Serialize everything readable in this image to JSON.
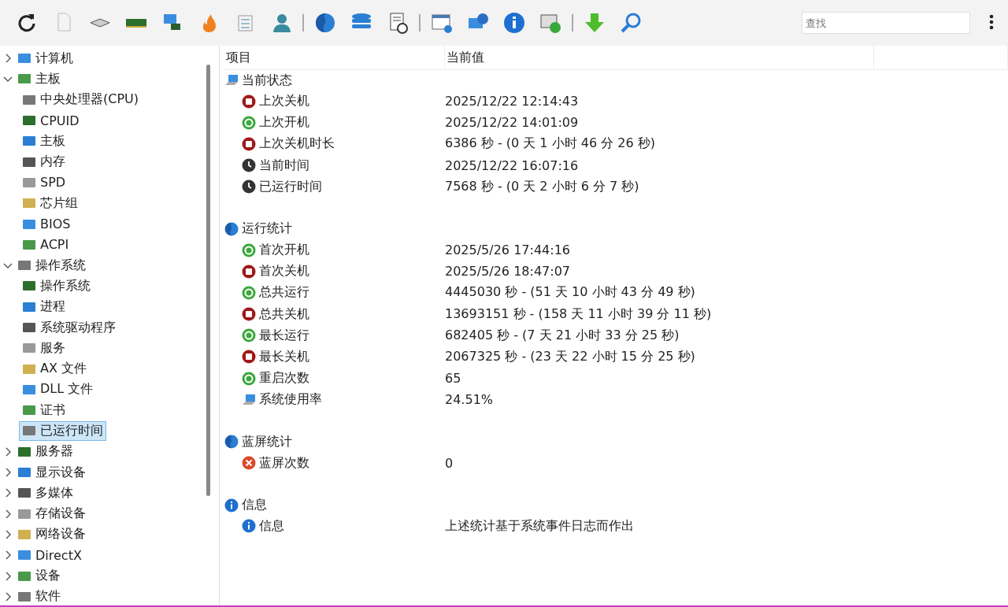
{
  "toolbar": {
    "search": {
      "placeholder": "查找"
    }
  },
  "tree": [
    {
      "label": "计算机",
      "expanded": false,
      "selected": false
    },
    {
      "label": "主板",
      "expanded": true,
      "selected": false,
      "children": [
        {
          "label": "中央处理器(CPU)",
          "selected": false
        },
        {
          "label": "CPUID",
          "selected": false
        },
        {
          "label": "主板",
          "selected": false
        },
        {
          "label": "内存",
          "selected": false
        },
        {
          "label": "SPD",
          "selected": false
        },
        {
          "label": "芯片组",
          "selected": false
        },
        {
          "label": "BIOS",
          "selected": false
        },
        {
          "label": "ACPI",
          "selected": false
        }
      ]
    },
    {
      "label": "操作系统",
      "expanded": true,
      "selected": false,
      "children": [
        {
          "label": "操作系统",
          "selected": false
        },
        {
          "label": "进程",
          "selected": false
        },
        {
          "label": "系统驱动程序",
          "selected": false
        },
        {
          "label": "服务",
          "selected": false
        },
        {
          "label": "AX 文件",
          "selected": false
        },
        {
          "label": "DLL 文件",
          "selected": false
        },
        {
          "label": "证书",
          "selected": false
        },
        {
          "label": "已运行时间",
          "selected": true
        }
      ]
    },
    {
      "label": "服务器",
      "expanded": false,
      "selected": false
    },
    {
      "label": "显示设备",
      "expanded": false,
      "selected": false
    },
    {
      "label": "多媒体",
      "expanded": false,
      "selected": false
    },
    {
      "label": "存储设备",
      "expanded": false,
      "selected": false
    },
    {
      "label": "网络设备",
      "expanded": false,
      "selected": false
    },
    {
      "label": "DirectX",
      "expanded": false,
      "selected": false
    },
    {
      "label": "设备",
      "expanded": false,
      "selected": false
    },
    {
      "label": "软件",
      "expanded": false,
      "selected": false
    }
  ],
  "table": {
    "columns": [
      "项目",
      "当前值"
    ],
    "groups": [
      {
        "title": "当前状态",
        "kind": "computer",
        "rows": [
          {
            "kind": "stop",
            "name": "上次关机",
            "value": "2025/12/22 12:14:43"
          },
          {
            "kind": "start",
            "name": "上次开机",
            "value": "2025/12/22 14:01:09"
          },
          {
            "kind": "stop",
            "name": "上次关机时长",
            "value": "6386 秒 - (0 天 1 小时 46 分 26 秒)"
          },
          {
            "kind": "clock",
            "name": "当前时间",
            "value": "2025/12/22 16:07:16"
          },
          {
            "kind": "clock",
            "name": "已运行时间",
            "value": "7568 秒 - (0 天 2 小时 6 分 7 秒)"
          }
        ]
      },
      {
        "title": "运行统计",
        "kind": "stats",
        "rows": [
          {
            "kind": "start",
            "name": "首次开机",
            "value": "2025/5/26 17:44:16"
          },
          {
            "kind": "stop",
            "name": "首次关机",
            "value": "2025/5/26 18:47:07"
          },
          {
            "kind": "start",
            "name": "总共运行",
            "value": "4445030 秒 - (51 天 10 小时 43 分 49 秒)"
          },
          {
            "kind": "stop",
            "name": "总共关机",
            "value": "13693151 秒 - (158 天 11 小时 39 分 11 秒)"
          },
          {
            "kind": "start",
            "name": "最长运行",
            "value": "682405 秒 - (7 天 21 小时 33 分 25 秒)"
          },
          {
            "kind": "stop",
            "name": "最长关机",
            "value": "2067325 秒 - (23 天 22 小时 15 分 25 秒)"
          },
          {
            "kind": "start",
            "name": "重启次数",
            "value": "65"
          },
          {
            "kind": "computer",
            "name": "系统使用率",
            "value": "24.51%"
          }
        ]
      },
      {
        "title": "蓝屏统计",
        "kind": "stats",
        "rows": [
          {
            "kind": "error",
            "name": "蓝屏次数",
            "value": "0"
          }
        ]
      },
      {
        "title": "信息",
        "kind": "info",
        "rows": [
          {
            "kind": "info",
            "name": "信息",
            "value": "上述统计基于系统事件日志而作出"
          }
        ]
      }
    ]
  }
}
